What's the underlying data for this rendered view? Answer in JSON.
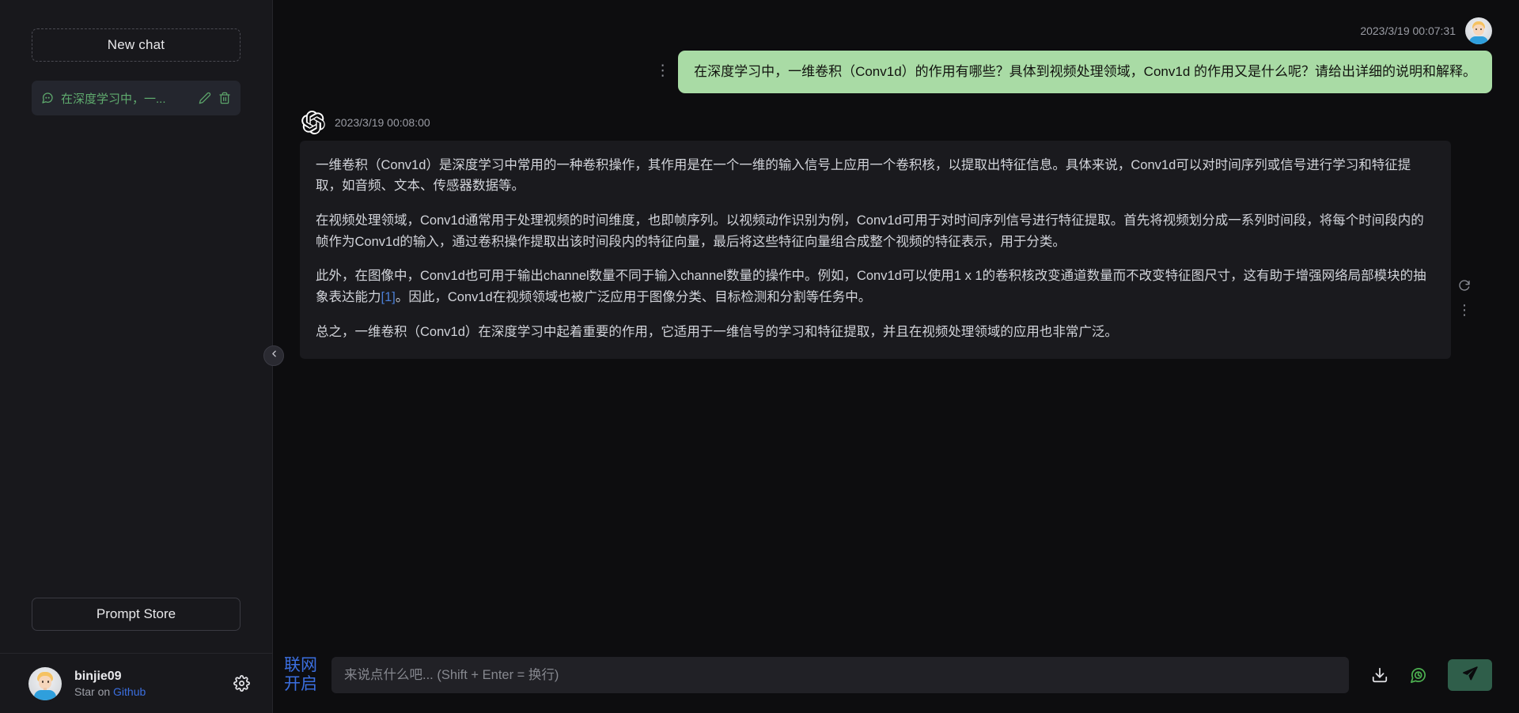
{
  "sidebar": {
    "new_chat_label": "New chat",
    "chats": [
      {
        "title": "在深度学习中，一...",
        "icon": "chat-bubble-icon",
        "edit_icon": "pencil-icon",
        "delete_icon": "trash-icon"
      }
    ],
    "prompt_store_label": "Prompt Store",
    "user": {
      "name": "binjie09",
      "sub_prefix": "Star on ",
      "sub_link": "Github",
      "settings_icon": "gear-icon",
      "avatar": "user-avatar"
    },
    "collapse_icon": "chevron-left-icon"
  },
  "conversation": {
    "user_message": {
      "timestamp": "2023/3/19 00:07:31",
      "text": "在深度学习中，一维卷积（Conv1d）的作用有哪些？具体到视频处理领域，Conv1d 的作用又是什么呢？请给出详细的说明和解释。",
      "menu_icon": "vertical-dots-icon",
      "avatar": "user-avatar"
    },
    "bot_message": {
      "timestamp": "2023/3/19 00:08:00",
      "logo": "openai-logo-icon",
      "paragraphs": [
        "一维卷积（Conv1d）是深度学习中常用的一种卷积操作，其作用是在一个一维的输入信号上应用一个卷积核，以提取出特征信息。具体来说，Conv1d可以对时间序列或信号进行学习和特征提取，如音频、文本、传感器数据等。",
        "在视频处理领域，Conv1d通常用于处理视频的时间维度，也即帧序列。以视频动作识别为例，Conv1d可用于对时间序列信号进行特征提取。首先将视频划分成一系列时间段，将每个时间段内的帧作为Conv1d的输入，通过卷积操作提取出该时间段内的特征向量，最后将这些特征向量组合成整个视频的特征表示，用于分类。",
        "总之，一维卷积（Conv1d）在深度学习中起着重要的作用，它适用于一维信号的学习和特征提取，并且在视频处理领域的应用也非常广泛。"
      ],
      "paragraph_with_link": {
        "before": "此外，在图像中，Conv1d也可用于输出channel数量不同于输入channel数量的操作中。例如，Conv1d可以使用1 x 1的卷积核改变通道数量而不改变特征图尺寸，这有助于增强网络局部模块的抽象表达能力",
        "link": "[1]",
        "after": "。因此，Conv1d在视频领域也被广泛应用于图像分类、目标检测和分割等任务中。"
      },
      "side_actions": [
        {
          "icon": "refresh-icon"
        },
        {
          "icon": "vertical-dots-icon"
        }
      ]
    }
  },
  "composer": {
    "network_toggle_line1": "联网",
    "network_toggle_line2": "开启",
    "input_value": "",
    "input_placeholder": "来说点什么吧... (Shift + Enter = 换行)",
    "actions": [
      {
        "icon": "download-icon",
        "name": "download-button"
      },
      {
        "icon": "chat-history-icon",
        "name": "history-button"
      }
    ],
    "send_icon": "send-paper-plane-icon"
  },
  "colors": {
    "app_background": "#0d0d0f",
    "sidebar_background": "#18181c",
    "user_bubble": "#a9dba5",
    "bot_bubble": "#1a1a1e",
    "accent_green": "#5fab6e",
    "accent_blue": "#3b6fe0",
    "send_button": "#2f5e4a"
  }
}
